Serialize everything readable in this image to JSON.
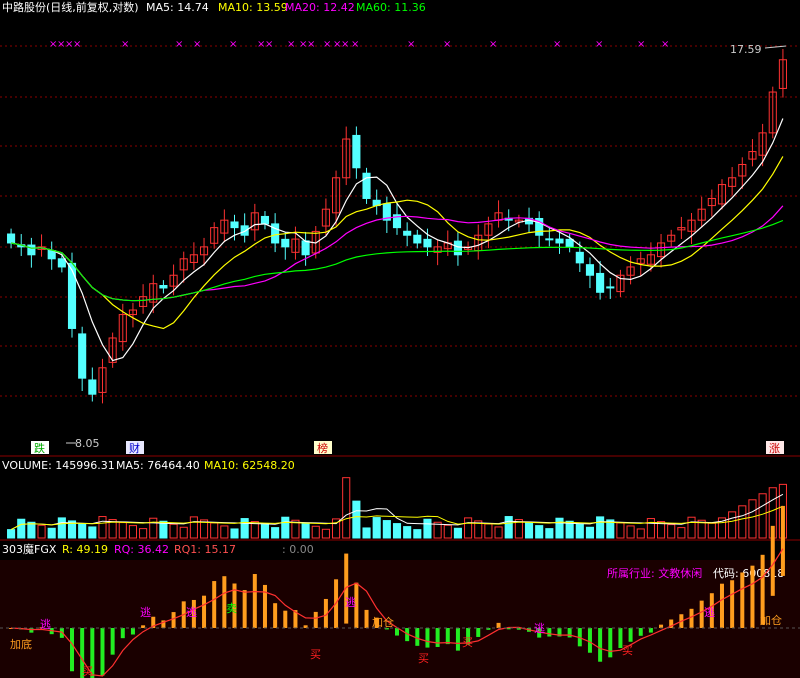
{
  "colors": {
    "bg": "#000000",
    "up": "#ff3232",
    "down": "#54ffff",
    "ma5": "#ffffff",
    "ma10": "#ffff00",
    "ma20": "#ff00ff",
    "ma60": "#00ff00",
    "grid": "#8b0000",
    "white": "#ffffff",
    "magenta": "#ff00ff",
    "orange": "#ff9d1e",
    "green_bar": "#22ee22",
    "red_mark": "#ff2020"
  },
  "header": {
    "title": "中路股份(日线,前复权,对数)",
    "ma5": "MA5: 14.74",
    "ma10": "MA10: 13.59",
    "ma20": "MA20: 12.42",
    "ma60": "MA60: 11.36"
  },
  "price_panel": {
    "high_label": "17.59",
    "low_label": "8.05",
    "event_labels": [
      "跌",
      "财",
      "榜",
      "涨"
    ]
  },
  "volume_panel": {
    "volume": "VOLUME: 145996.31",
    "ma5": "MA5: 76464.40",
    "ma10": "MA10: 62548.20"
  },
  "indicator_panel": {
    "name": "303魔FGX",
    "r": "R: 49.19",
    "rq": "RQ: 36.42",
    "rq1": "RQ1: 15.17",
    "extra": ": 0.00",
    "industry_label": "所属行业: 文教休闲",
    "code_label": "代码: 600818",
    "signals": {
      "escape": "逃",
      "buy": "买",
      "add": "加仓",
      "add_bottom": "加底",
      "sell": "卖"
    }
  },
  "chart_data": {
    "type": "candlestick",
    "scale": "log",
    "price_range": [
      7.5,
      19.0
    ],
    "price_high": 17.59,
    "price_low": 8.05,
    "ma_last": {
      "MA5": 14.74,
      "MA10": 13.59,
      "MA20": 12.42,
      "MA60": 11.36
    },
    "closes": [
      11.6,
      11.5,
      11.3,
      11.5,
      11.2,
      11.0,
      9.6,
      8.6,
      8.3,
      8.8,
      9.4,
      9.9,
      10.0,
      10.3,
      10.6,
      10.5,
      10.8,
      11.2,
      11.3,
      11.5,
      12.0,
      12.2,
      12.0,
      11.8,
      12.4,
      12.1,
      11.6,
      11.5,
      11.7,
      11.3,
      11.9,
      12.5,
      13.4,
      14.6,
      13.7,
      12.8,
      12.6,
      12.2,
      12.0,
      11.8,
      11.6,
      11.5,
      11.5,
      11.6,
      11.3,
      11.5,
      11.8,
      12.1,
      12.4,
      12.2,
      12.2,
      12.1,
      11.8,
      11.7,
      11.6,
      11.5,
      11.1,
      10.8,
      10.4,
      10.5,
      10.8,
      11.0,
      11.2,
      11.3,
      11.6,
      11.8,
      12.0,
      12.2,
      12.5,
      12.8,
      13.2,
      13.4,
      13.8,
      14.2,
      14.8,
      16.2,
      17.4
    ],
    "volume_ma": {
      "MA5": 76464.4,
      "MA10": 62548.2
    },
    "volume_last": 145996.31,
    "indicator": {
      "R": 49.19,
      "RQ": 36.42,
      "RQ1": 15.17
    }
  }
}
